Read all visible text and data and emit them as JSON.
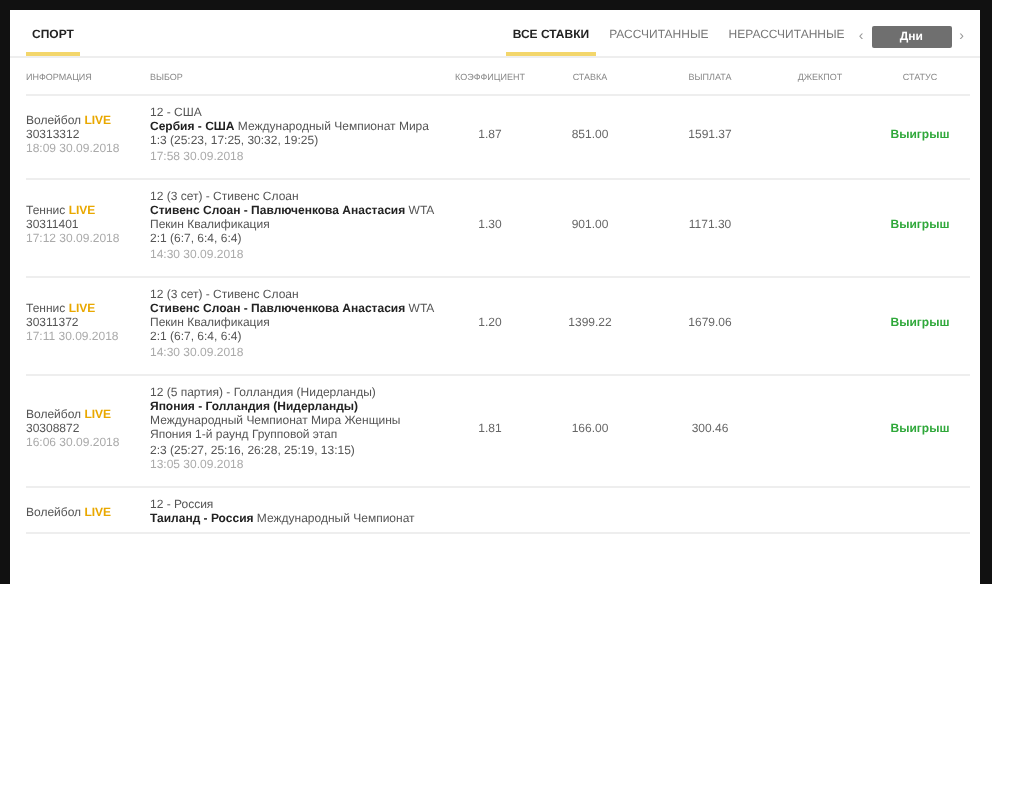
{
  "sport_tab": {
    "label": "СПОРТ",
    "selected": true
  },
  "filter_tabs": [
    {
      "label": "ВСЕ СТАВКИ",
      "selected": true
    },
    {
      "label": "РАССЧИТАННЫЕ",
      "selected": false
    },
    {
      "label": "НЕРАССЧИТАННЫЕ",
      "selected": false
    }
  ],
  "period": {
    "prev": "‹",
    "label": "Дни",
    "next": "›"
  },
  "columns": [
    "ИНФОРМАЦИЯ",
    "ВЫБОР",
    "КОЭФФИЦИЕНТ",
    "СТАВКА",
    "ВЫПЛАТА",
    "ДЖЕКПОТ",
    "СТАТУС"
  ],
  "rows": [
    {
      "sport": "Волейбол",
      "live": "LIVE",
      "id": "30313312",
      "time": "18:09 30.09.2018",
      "market": "12 - США",
      "event": "**Сербия - США** Международный Чемпионат Мира",
      "details": [
        "1:3 (25:23, 17:25, 30:32, 19:25)"
      ],
      "start": "17:58 30.09.2018",
      "odds": "1.87",
      "stake": "851.00",
      "payout": "1591.37",
      "status": "Выигрыш"
    },
    {
      "sport": "Теннис",
      "live": "LIVE",
      "id": "30311401",
      "time": "17:12 30.09.2018",
      "market": "12 (3 сет) - Стивенс Слоан",
      "event": "**Стивенс Слоан - Павлюченкова Анастасия** WTA",
      "details": [
        "Пекин Квалификация",
        "2:1 (6:7, 6:4, 6:4)"
      ],
      "start": "14:30 30.09.2018",
      "odds": "1.30",
      "stake": "901.00",
      "payout": "1171.30",
      "status": "Выигрыш"
    },
    {
      "sport": "Теннис",
      "live": "LIVE",
      "id": "30311372",
      "time": "17:11 30.09.2018",
      "market": "12 (3 сет) - Стивенс Слоан",
      "event": "**Стивенс Слоан - Павлюченкова Анастасия** WTA",
      "details": [
        "Пекин Квалификация",
        "2:1 (6:7, 6:4, 6:4)"
      ],
      "start": "14:30 30.09.2018",
      "odds": "1.20",
      "stake": "1399.22",
      "payout": "1679.06",
      "status": "Выигрыш"
    },
    {
      "sport": "Волейбол",
      "live": "LIVE",
      "id": "30308872",
      "time": "16:06 30.09.2018",
      "market": "12 (5 партия) - Голландия (Нидерланды)",
      "event": "**Япония - Голландия (Нидерланды)**",
      "details": [
        "Международный Чемпионат Мира Женщины",
        "Япония 1-й раунд Групповой этап",
        "2:3 (25:27, 25:16, 26:28, 25:19, 13:15)"
      ],
      "start": "13:05 30.09.2018",
      "odds": "1.81",
      "stake": "166.00",
      "payout": "300.46",
      "status": "Выигрыш"
    },
    {
      "sport": "Волейбол",
      "live": "LIVE",
      "market": "12 - Россия",
      "event": "**Таиланд - Россия** Международный Чемпионат"
    }
  ]
}
